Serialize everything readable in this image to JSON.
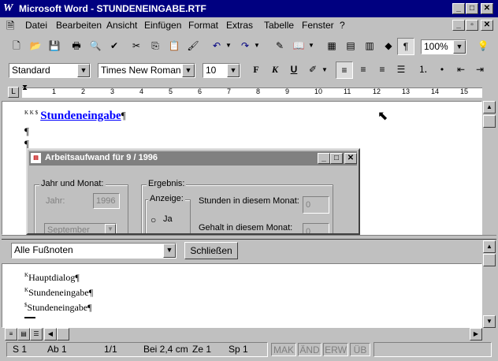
{
  "window": {
    "logo": "W",
    "title": "Microsoft Word - STUNDENEINGABE.RTF",
    "colors": {
      "titlebar": "#000080",
      "face": "#c0c0c0",
      "link_blue": "#0000ff"
    }
  },
  "menu": {
    "items": [
      "Datei",
      "Bearbeiten",
      "Ansicht",
      "Einfügen",
      "Format",
      "Extras",
      "Tabelle",
      "Fenster",
      "?"
    ]
  },
  "toolbar": {
    "zoom": "100%"
  },
  "formatbar": {
    "style": "Standard",
    "font": "Times New Roman",
    "size": "10",
    "bold": "F",
    "italic": "K",
    "underline": "U"
  },
  "ruler": {
    "numbers": [
      "1",
      "2",
      "3",
      "4",
      "5",
      "6",
      "7",
      "8",
      "9",
      "10",
      "11",
      "12",
      "13",
      "14",
      "15"
    ]
  },
  "document": {
    "footnote_marks": "K K $",
    "heading": "Stundeneingabe",
    "pilcrow": "¶"
  },
  "dialog": {
    "title": "Arbeitsaufwand für 9 / 1996",
    "group_month": "Jahr und Monat:",
    "label_year": "Jahr:",
    "value_year": "1996",
    "value_month": "September",
    "group_result": "Ergebnis:",
    "group_display": "Anzeige:",
    "radio_yes": "Ja",
    "label_hours": "Stunden in diesem Monat:",
    "value_hours": "0",
    "label_salary": "Gehalt in diesem Monat:",
    "value_salary": "0"
  },
  "footnote_pane": {
    "filter": "Alle Fußnoten",
    "close_button": "Schließen",
    "entries": [
      {
        "mark": "K",
        "text": "Hauptdialog¶"
      },
      {
        "mark": "K",
        "text": "Stundeneingabe¶"
      },
      {
        "mark": "$",
        "text": "Stundeneingabe¶"
      }
    ]
  },
  "statusbar": {
    "page": "S 1",
    "section": "Ab 1",
    "pages": "1/1",
    "position": "Bei 2,4 cm",
    "line": "Ze 1",
    "column": "Sp 1",
    "mak": "MAK",
    "and": "ÄND",
    "erw": "ERW",
    "ub": "ÜB"
  }
}
